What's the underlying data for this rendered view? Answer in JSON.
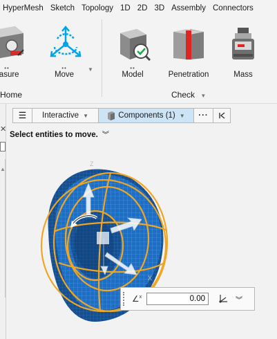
{
  "menubar": {
    "items": [
      "HyperMesh",
      "Sketch",
      "Topology",
      "1D",
      "2D",
      "3D",
      "Assembly",
      "Connectors"
    ]
  },
  "ribbon": {
    "tools": {
      "measure": "easure",
      "move": "Move",
      "model": "Model",
      "penetration": "Penetration",
      "mass": "Mass"
    },
    "groups": {
      "home": "Home",
      "check": "Check"
    }
  },
  "toolbar": {
    "mode": "Interactive",
    "selection": "Components (1)",
    "more": "···"
  },
  "viewport": {
    "instruction": "Select entities to move.",
    "axis_z": "Z",
    "axis_x": "X",
    "value_input": "0.00"
  },
  "colors": {
    "model_blue": "#1e6fc4",
    "wireframe_orange": "#f0a623",
    "accent_selected": "#cce4f6"
  }
}
